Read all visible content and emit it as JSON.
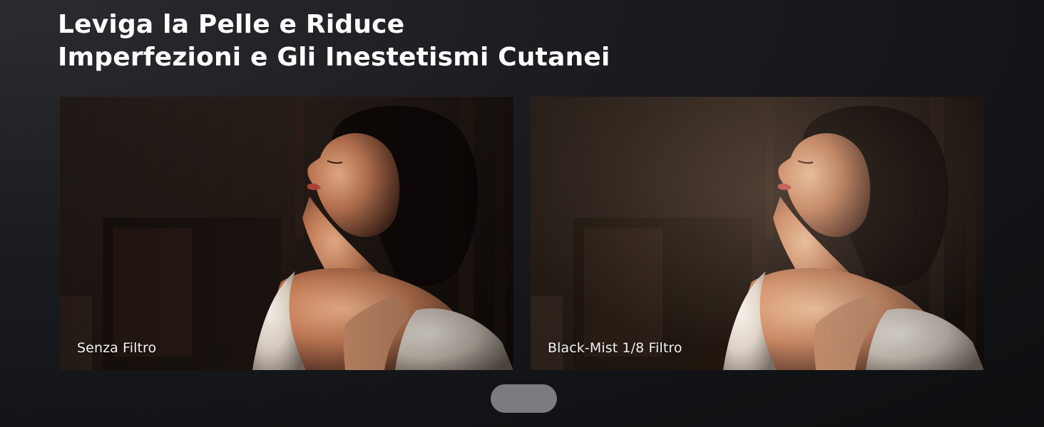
{
  "headline": {
    "line1": "Leviga la Pelle e Riduce",
    "line2": "Imperfezioni e Gli Inestetismi Cutanei"
  },
  "comparison": {
    "left": {
      "caption": "Senza Filtro",
      "image": "portrait-photo-no-filter"
    },
    "right": {
      "caption": "Black-Mist 1/8 Filtro",
      "image": "portrait-photo-black-mist"
    }
  },
  "colors": {
    "background": "#16171a",
    "headline_text": "#ffffff",
    "caption_text": "#f3f3f3",
    "pager_pill": "#7b7c80"
  }
}
